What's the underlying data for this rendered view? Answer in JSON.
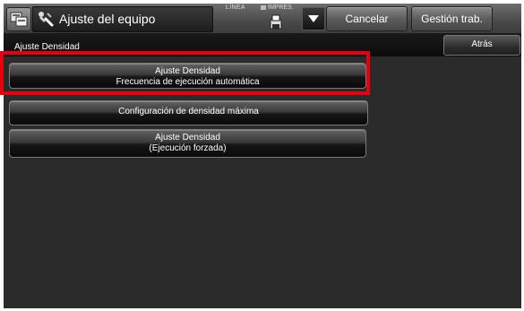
{
  "topbar": {
    "title": "Ajuste del equipo",
    "status_line": "LÍNEA",
    "status_print": "IMPRES.",
    "cancel_label": "Cancelar",
    "jobs_label": "Gestión trab."
  },
  "subheader": {
    "page_title": "Ajuste Densidad",
    "back_label": "Atrás"
  },
  "menu": {
    "items": [
      {
        "line1": "Ajuste Densidad",
        "line2": "Frecuencia de ejecución automática",
        "highlighted": true
      },
      {
        "line1": "Configuración de densidad máxima"
      },
      {
        "line1": "Ajuste Densidad",
        "line2": "(Ejecución forzada)"
      }
    ]
  },
  "colors": {
    "highlight": "#e60012",
    "background": "#2b2b2b"
  },
  "icons": [
    "home-icon",
    "settings-wrench-icon",
    "printer-icon",
    "chevron-down-icon"
  ]
}
